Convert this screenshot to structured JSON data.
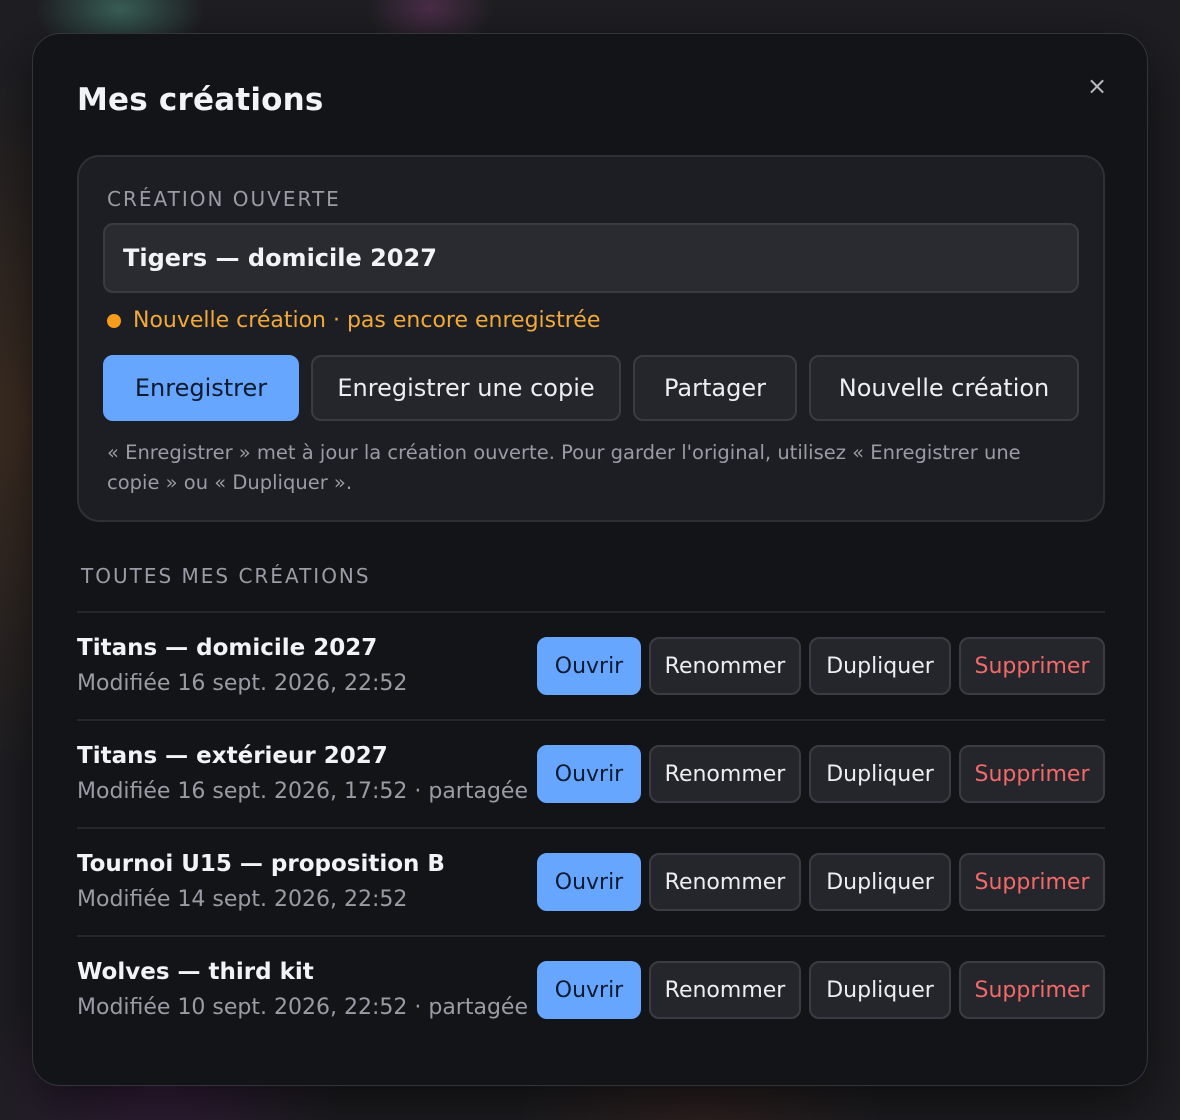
{
  "modal": {
    "title": "Mes créations",
    "close_label": "×"
  },
  "current": {
    "section_label": "CRÉATION OUVERTE",
    "name_value": "Tigers — domicile 2027",
    "status_text": "Nouvelle création · pas encore enregistrée",
    "status_color": "#f49c1c",
    "buttons": {
      "save": "Enregistrer",
      "save_copy": "Enregistrer une copie",
      "share": "Partager",
      "new": "Nouvelle création"
    },
    "helper_text": "« Enregistrer » met à jour la création ouverte. Pour garder l'original, utilisez « Enregistrer une copie » ou « Dupliquer »."
  },
  "list": {
    "section_label": "TOUTES MES CRÉATIONS",
    "actions": {
      "open": "Ouvrir",
      "rename": "Renommer",
      "duplicate": "Dupliquer",
      "delete": "Supprimer"
    },
    "items": [
      {
        "title": "Titans — domicile 2027",
        "meta": "Modifiée 16 sept. 2026, 22:52"
      },
      {
        "title": "Titans — extérieur 2027",
        "meta": "Modifiée 16 sept. 2026, 17:52 · partagée"
      },
      {
        "title": "Tournoi U15 — proposition B",
        "meta": "Modifiée 14 sept. 2026, 22:52"
      },
      {
        "title": "Wolves — third kit",
        "meta": "Modifiée 10 sept. 2026, 22:52 · partagée"
      }
    ]
  },
  "colors": {
    "accent": "#66a6ff",
    "danger": "#f16a6a",
    "warning": "#f0a93a"
  }
}
